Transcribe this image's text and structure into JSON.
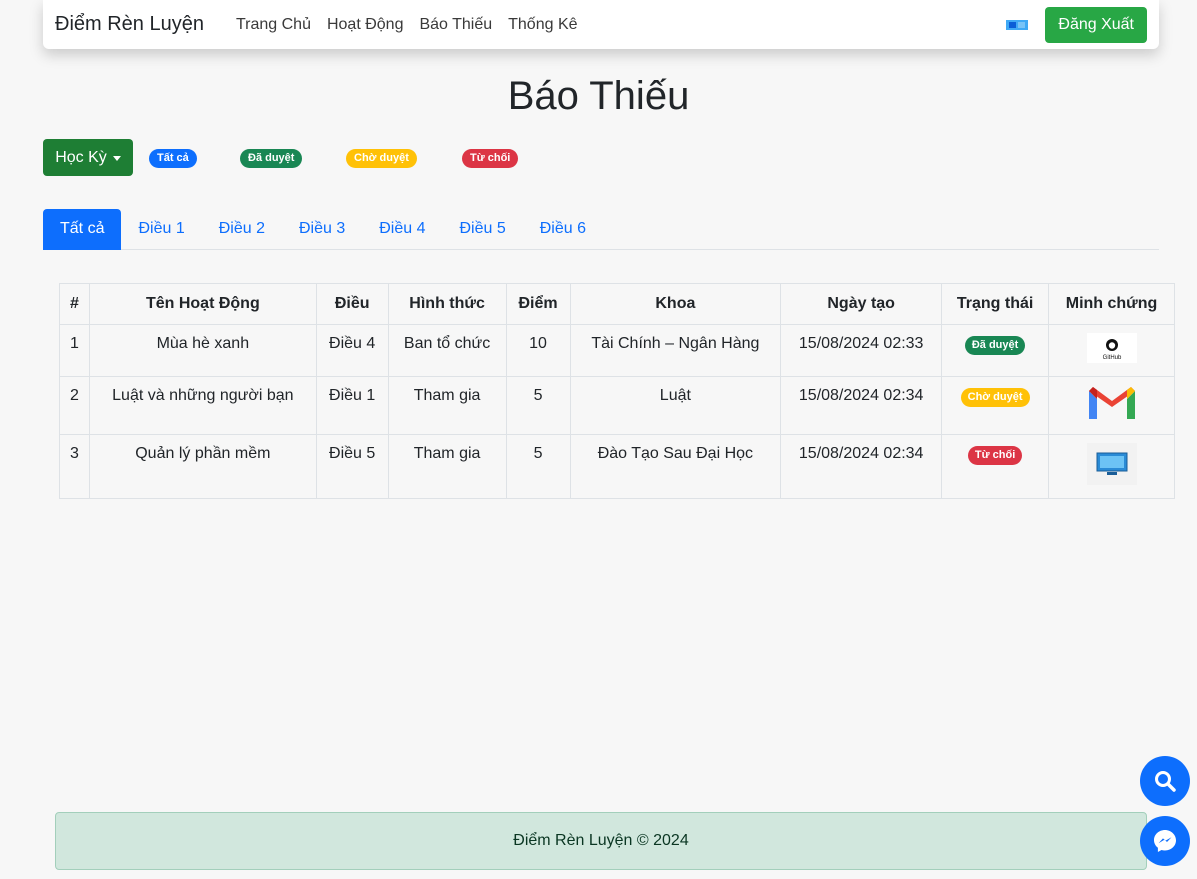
{
  "navbar": {
    "brand": "Điểm Rèn Luyện",
    "links": [
      "Trang Chủ",
      "Hoạt Động",
      "Báo Thiếu",
      "Thống Kê"
    ],
    "logout_label": "Đăng Xuất"
  },
  "page": {
    "title": "Báo Thiếu"
  },
  "filters": {
    "semester_label": "Học Kỳ",
    "status_badges": [
      "Tất cả",
      "Đã duyệt",
      "Chờ duyệt",
      "Từ chối"
    ]
  },
  "tabs": [
    "Tất cả",
    "Điều 1",
    "Điều 2",
    "Điều 3",
    "Điều 4",
    "Điều 5",
    "Điều 6"
  ],
  "table": {
    "headers": [
      "#",
      "Tên Hoạt Động",
      "Điều",
      "Hình thức",
      "Điểm",
      "Khoa",
      "Ngày tạo",
      "Trạng thái",
      "Minh chứng"
    ],
    "rows": [
      {
        "no": "1",
        "name": "Mùa hè xanh",
        "article": "Điều 4",
        "form": "Ban tổ chức",
        "score": "10",
        "faculty": "Tài Chính – Ngân Hàng",
        "created": "15/08/2024 02:33",
        "status": "Đã duyệt",
        "proof_icon": "github-logo-icon"
      },
      {
        "no": "2",
        "name": "Luật và những người bạn",
        "article": "Điều 1",
        "form": "Tham gia",
        "score": "5",
        "faculty": "Luật",
        "created": "15/08/2024 02:34",
        "status": "Chờ duyệt",
        "proof_icon": "gmail-logo-icon"
      },
      {
        "no": "3",
        "name": "Quản lý phần mềm",
        "article": "Điều 5",
        "form": "Tham gia",
        "score": "5",
        "faculty": "Đào Tạo Sau Đại Học",
        "created": "15/08/2024 02:34",
        "status": "Từ chối",
        "proof_icon": "computer-icon"
      }
    ],
    "github_caption": "GitHub"
  },
  "footer": {
    "text": "Điểm Rèn Luyện © 2024"
  },
  "colors": {
    "primary": "#0d6efd",
    "success": "#28a745",
    "warning": "#ffc107",
    "danger": "#dc3545"
  }
}
